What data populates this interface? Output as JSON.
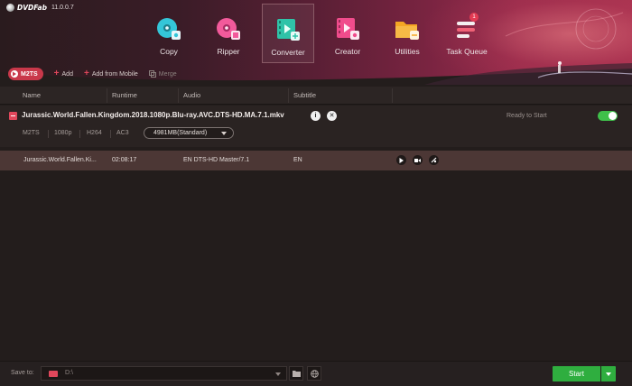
{
  "app": {
    "brand": "DVDFab",
    "version": "11.0.0.7"
  },
  "modules": [
    {
      "label": "Copy",
      "icon": "copy-disc-icon"
    },
    {
      "label": "Ripper",
      "icon": "ripper-disc-icon"
    },
    {
      "label": "Converter",
      "icon": "converter-film-icon",
      "active": true
    },
    {
      "label": "Creator",
      "icon": "creator-film-icon"
    },
    {
      "label": "Utilities",
      "icon": "utilities-folder-icon"
    },
    {
      "label": "Task Queue",
      "icon": "task-queue-icon",
      "badge": "1"
    }
  ],
  "toolbar": {
    "profile": "M2TS",
    "add": "Add",
    "add_mobile": "Add from Mobile",
    "merge": "Merge"
  },
  "columns": {
    "name": "Name",
    "runtime": "Runtime",
    "audio": "Audio",
    "subtitle": "Subtitle"
  },
  "file": {
    "name": "Jurassic.World.Fallen.Kingdom.2018.1080p.Blu-ray.AVC.DTS-HD.MA.7.1.mkv",
    "status": "Ready to Start",
    "format": "M2TS",
    "resolution": "1080p",
    "codec": "H264",
    "audio_codec": "AC3",
    "size": "4981MB(Standard)"
  },
  "track": {
    "name": "Jurassic.World.Fallen.Ki...",
    "runtime": "02:08:17",
    "audio": "EN  DTS-HD Master/7.1",
    "subtitle": "EN"
  },
  "footer": {
    "save_label": "Save to:",
    "save_path": "D:\\",
    "start": "Start"
  },
  "colors": {
    "accent": "#e0475b",
    "start": "#2fae3f",
    "toggle": "#3fbf4a"
  }
}
